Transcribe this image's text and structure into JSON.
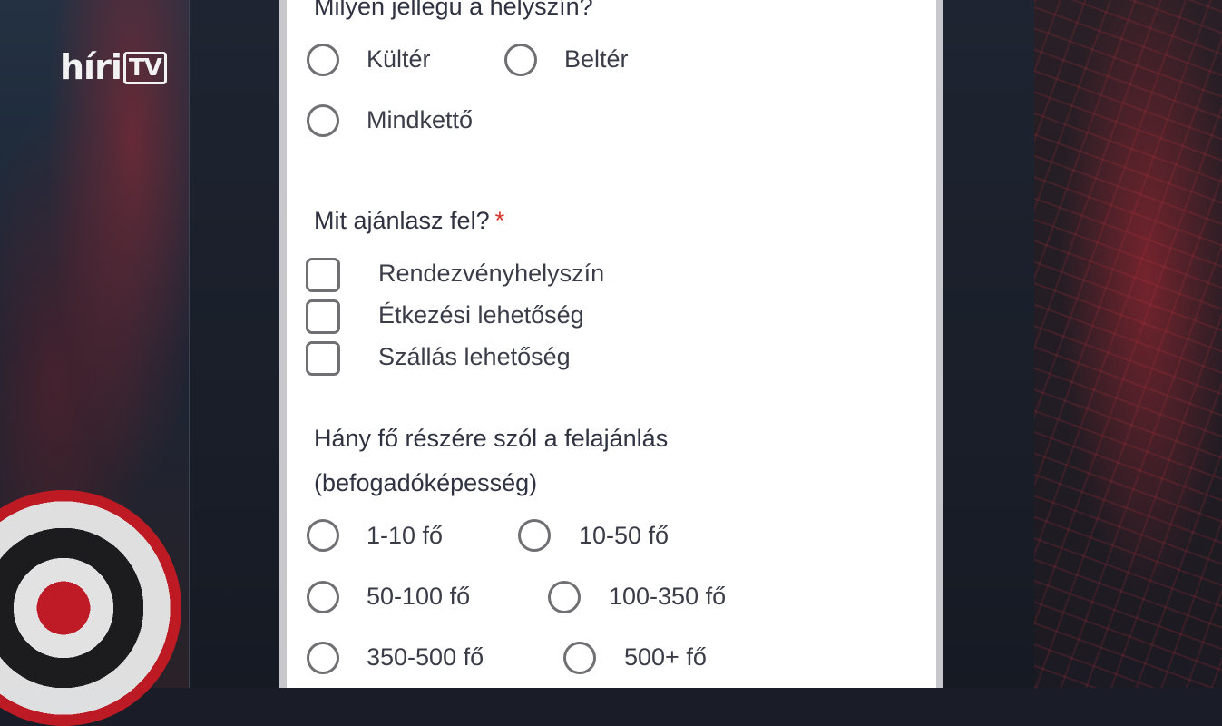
{
  "brand": {
    "logo_text": "híri",
    "logo_tv": "TV"
  },
  "form": {
    "q1": {
      "title": "Milyen jellegű a helyszín?",
      "options": [
        "Kültér",
        "Beltér",
        "Mindkettő"
      ]
    },
    "q2": {
      "title": "Mit ajánlasz fel?",
      "required_mark": "*",
      "options": [
        "Rendezvényhelyszín",
        "Étkezési lehetőség",
        "Szállás lehetőség"
      ]
    },
    "q3": {
      "title_line1": "Hány fő részére szól a felajánlás",
      "title_line2": "(befogadóképesség)",
      "options": [
        "1-10 fő",
        "10-50 fő",
        "50-100 fő",
        "100-350 fő",
        "350-500 fő",
        "500+ fő"
      ]
    }
  },
  "colors": {
    "required": "#d93025",
    "text": "#2f3240",
    "border": "#6f6f74"
  }
}
